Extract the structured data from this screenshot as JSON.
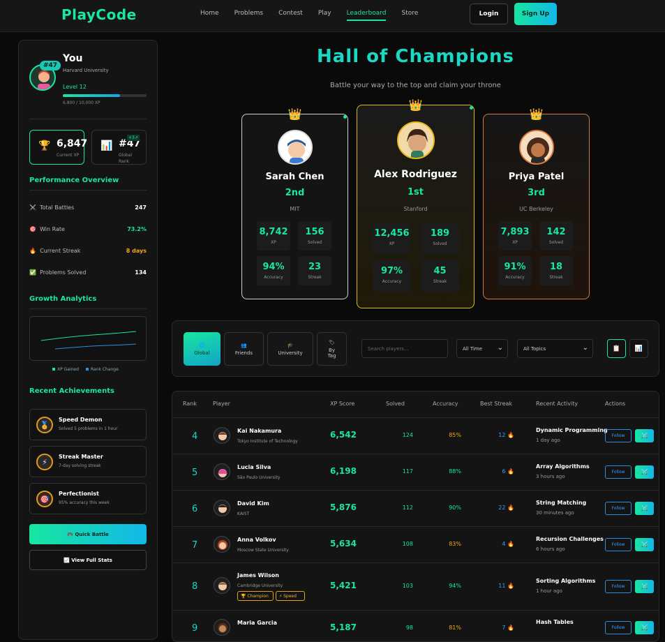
{
  "header": {
    "logo": "PlayCode",
    "nav": [
      "Home",
      "Problems",
      "Contest",
      "Play",
      "Leaderboard",
      "Store"
    ],
    "active_nav": "Leaderboard",
    "login": "Login",
    "signup": "Sign Up"
  },
  "profile": {
    "name": "You",
    "university": "Harvard University",
    "rank_badge": "#47",
    "level": "Level 12",
    "xp_progress": 0.68,
    "xp_text": "6,800 / 10,000 XP",
    "stat_xp_value": "6,847",
    "stat_xp_label": "Current XP",
    "stat_rank_value": "#47",
    "stat_rank_label": "Global Rank",
    "stat_rank_delta": "+3↗"
  },
  "performance": {
    "title": "Performance Overview",
    "rows": [
      {
        "icon": "swords-icon",
        "label": "Total Battles",
        "value": "247",
        "color": "#ffffff"
      },
      {
        "icon": "target-icon",
        "label": "Win Rate",
        "value": "73.2%",
        "color": "#19e6a0"
      },
      {
        "icon": "fire-icon",
        "label": "Current Streak",
        "value": "8 days",
        "color": "#f2a516"
      },
      {
        "icon": "check-icon",
        "label": "Problems Solved",
        "value": "134",
        "color": "#ffffff"
      }
    ]
  },
  "growth": {
    "title": "Growth Analytics",
    "legend_xp": "XP Gained",
    "legend_rank": "Rank Change"
  },
  "achievements": {
    "title": "Recent Achievements",
    "items": [
      {
        "icon": "medal-icon",
        "title": "Speed Demon",
        "subtitle": "Solved 5 problems in 1 hour"
      },
      {
        "icon": "lightning-icon",
        "title": "Streak Master",
        "subtitle": "7-day solving streak"
      },
      {
        "icon": "bullseye-icon",
        "title": "Perfectionist",
        "subtitle": "95% accuracy this week"
      }
    ]
  },
  "actions": {
    "quick_battle": "🎮 Quick Battle",
    "full_stats": "📈 View Full Stats"
  },
  "hero": {
    "title": "Hall of Champions",
    "subtitle": "Battle your way to the top and claim your throne"
  },
  "podium": [
    {
      "name": "Sarah Chen",
      "place": "2nd",
      "school": "MIT",
      "xp": "8,742",
      "solved": "156",
      "accuracy": "94%",
      "streak": "23"
    },
    {
      "name": "Alex Rodriguez",
      "place": "1st",
      "school": "Stanford",
      "xp": "12,456",
      "solved": "189",
      "accuracy": "97%",
      "streak": "45"
    },
    {
      "name": "Priya Patel",
      "place": "3rd",
      "school": "UC Berkeley",
      "xp": "7,893",
      "solved": "142",
      "accuracy": "91%",
      "streak": "18"
    }
  ],
  "podium_labels": {
    "xp": "XP",
    "solved": "Solved",
    "accuracy": "Accuracy",
    "streak": "Streak"
  },
  "filters": {
    "tabs": [
      {
        "icon": "globe-icon",
        "glyph": "🌐",
        "label": "Global"
      },
      {
        "icon": "friends-icon",
        "glyph": "👥",
        "label": "Friends"
      },
      {
        "icon": "graduation-icon",
        "glyph": "🎓",
        "label": "University"
      },
      {
        "icon": "tag-icon",
        "glyph": "🏷",
        "label": "By Tag"
      }
    ],
    "search_placeholder": "Search players...",
    "time_select": "All Time",
    "topic_select": "All Topics"
  },
  "table": {
    "headers": [
      "Rank",
      "Player",
      "XP Score",
      "Solved",
      "Accuracy",
      "Best Streak",
      "Recent Activity",
      "Actions"
    ],
    "follow_label": "Follow",
    "rows": [
      {
        "rank": "4",
        "name": "Kai Nakamura",
        "university": "Tokyo Institute of Technology",
        "xp": "6,542",
        "solved": "124",
        "accuracy": "85%",
        "accuracy_color": "#f2a516",
        "streak": "12",
        "activity": "Dynamic Programming",
        "time": "1 day ago"
      },
      {
        "rank": "5",
        "name": "Lucia Silva",
        "university": "São Paulo University",
        "xp": "6,198",
        "solved": "117",
        "accuracy": "88%",
        "accuracy_color": "#19e6a0",
        "streak": "6",
        "activity": "Array Algorithms",
        "time": "3 hours ago"
      },
      {
        "rank": "6",
        "name": "David Kim",
        "university": "KAIST",
        "xp": "5,876",
        "solved": "112",
        "accuracy": "90%",
        "accuracy_color": "#19e6a0",
        "streak": "22",
        "activity": "String Matching",
        "time": "30 minutes ago"
      },
      {
        "rank": "7",
        "name": "Anna Volkov",
        "university": "Moscow State University",
        "xp": "5,634",
        "solved": "108",
        "accuracy": "83%",
        "accuracy_color": "#f2a516",
        "streak": "4",
        "activity": "Recursion Challenges",
        "time": "6 hours ago"
      },
      {
        "rank": "8",
        "name": "James Wilson",
        "university": "Cambridge University",
        "xp": "5,421",
        "solved": "103",
        "accuracy": "94%",
        "accuracy_color": "#19e6a0",
        "streak": "11",
        "activity": "Sorting Algorithms",
        "time": "1 hour ago",
        "tags": [
          "🏆 Champion",
          "⚡ Speed"
        ]
      },
      {
        "rank": "9",
        "name": "Maria Garcia",
        "university": "",
        "xp": "5,187",
        "solved": "98",
        "accuracy": "81%",
        "accuracy_color": "#f2a516",
        "streak": "7",
        "activity": "Hash Tables",
        "time": ""
      }
    ]
  }
}
